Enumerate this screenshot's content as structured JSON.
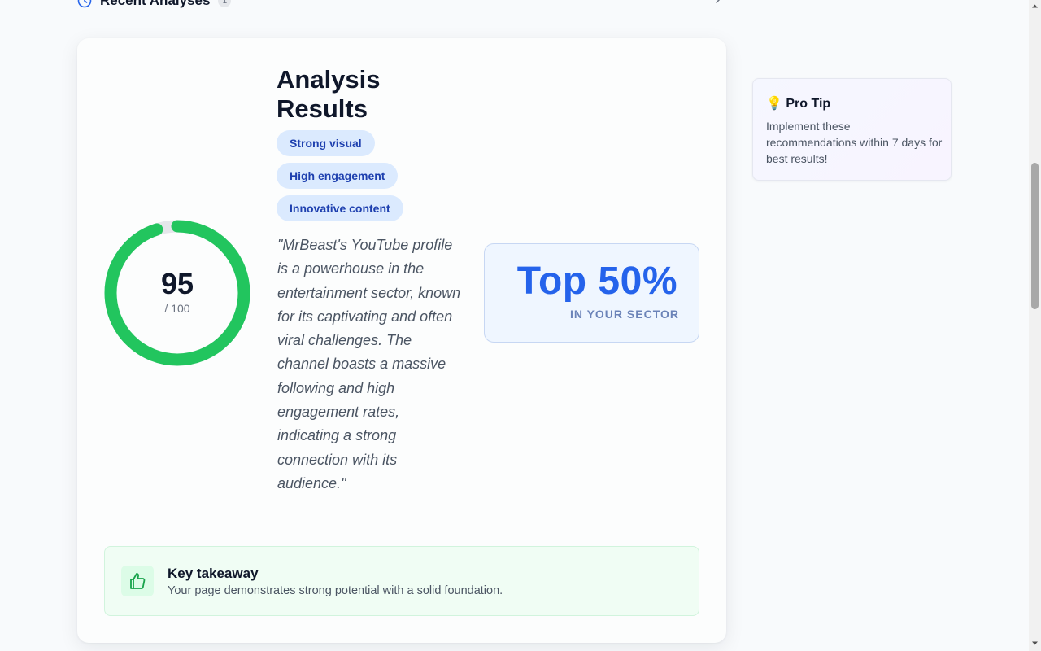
{
  "recent": {
    "title": "Recent Analyses",
    "count": "1"
  },
  "score": {
    "value": "95",
    "max": "/ 100",
    "fraction": 0.95,
    "color": "#22c55e"
  },
  "results": {
    "title": "Analysis Results",
    "tags": [
      "Strong visual",
      "High engagement",
      "Innovative content"
    ],
    "quote": "\"MrBeast's YouTube profile is a powerhouse in the entertainment sector, known for its captivating and often viral challenges. The channel boasts a massive following and high engagement rates, indicating a strong connection with its audience.\""
  },
  "rank": {
    "value": "Top 50%",
    "caption": "IN YOUR SECTOR"
  },
  "takeaway": {
    "title": "Key takeaway",
    "text": "Your page demonstrates strong potential with a solid foundation."
  },
  "protip": {
    "icon": "💡",
    "title": "Pro Tip",
    "text": "Implement these recommendations within 7 days for best results!"
  }
}
